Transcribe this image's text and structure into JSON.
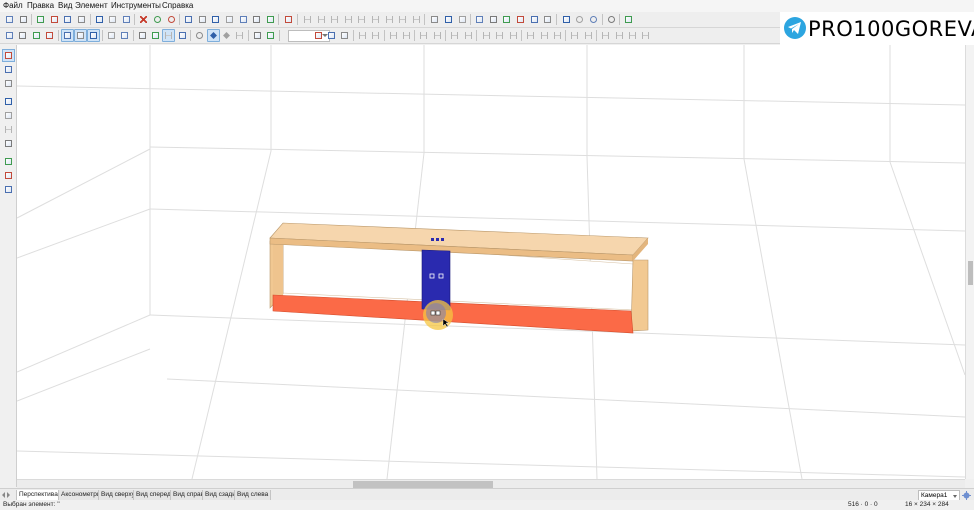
{
  "menu": [
    "Файл",
    "Правка",
    "Вид",
    "Элемент",
    "Инструменты",
    "Справка"
  ],
  "brand": {
    "name": "PRO100GOREVA",
    "icon": "telegram-icon",
    "color": "#2ca5e0"
  },
  "toolbar1": {
    "icons": [
      "new-file-icon",
      "open-file-icon",
      "save-icon",
      "save-as-icon",
      "print-icon",
      "print-preview-icon",
      "cut-icon",
      "copy-icon",
      "paste-icon",
      "delete-icon",
      "globe-icon",
      "circle-icon",
      "properties-icon",
      "frame-icon",
      "frame-icon",
      "frame-icon",
      "frame-icon",
      "frame-icon",
      "frame-icon",
      "sum-icon",
      "align-icon",
      "align-icon",
      "align-icon",
      "align-icon",
      "align-icon",
      "align-icon",
      "align-icon",
      "align-icon",
      "align-icon",
      "grid-icon",
      "grid-icon",
      "grid-icon",
      "arrow-icon",
      "arrow-icon",
      "rotate-icon",
      "move-icon",
      "mirror-icon",
      "mirror-icon",
      "frame-icon",
      "ellipse-icon",
      "ellipse-icon",
      "eye-icon",
      "gear-icon"
    ]
  },
  "toolbar2": {
    "icons": [
      "box-icon",
      "box-icon",
      "box-icon",
      "box-icon",
      "box-icon",
      "box-icon",
      "box-icon",
      "color-icon",
      "color-icon",
      "light-icon",
      "shape-icon",
      "dimension-icon",
      "list-icon",
      "eye-icon",
      "diamond-icon",
      "diamond-icon",
      "dimension-icon",
      "magnet-icon",
      "tool-icon",
      "zoom-icon",
      "zoom-icon",
      "zoom-icon",
      "align-icon",
      "align-icon",
      "align-icon",
      "align-icon",
      "align-icon",
      "align-icon",
      "align-icon",
      "align-icon",
      "dimension-icon",
      "dimension-icon",
      "dimension-icon",
      "dimension-icon",
      "dimension-icon",
      "dimension-icon",
      "dimension-icon",
      "dimension-icon",
      "dimension-icon",
      "dimension-icon",
      "dimension-icon",
      "dimension-icon"
    ],
    "combo_value": ""
  },
  "left_tools": [
    "select-arrow-icon",
    "move-icon",
    "zoom-icon",
    "pencil-icon",
    "shape-icon",
    "dimension-icon",
    "tool-icon",
    "tool-icon",
    "tool-icon",
    "tool-icon"
  ],
  "view_tabs": [
    "Перспектива",
    "Аксонометрия",
    "Вид сверху",
    "Вид спереди",
    "Вид справа",
    "Вид сзади",
    "Вид слева"
  ],
  "active_tab": "Перспектива",
  "camera": "Камера1",
  "status": {
    "left": "Выбран элемент: ''",
    "coord1": "516 · 0 · 0",
    "coord2": "16 × 234 × 284"
  },
  "colors": {
    "wood_top": "#f5d5ab",
    "wood_side": "#f2c992",
    "bottom_selected": "#fb6a47",
    "divider_selected": "#2a2aaf",
    "highlight": "#f5c542",
    "grid_line": "#dcdcdc"
  }
}
